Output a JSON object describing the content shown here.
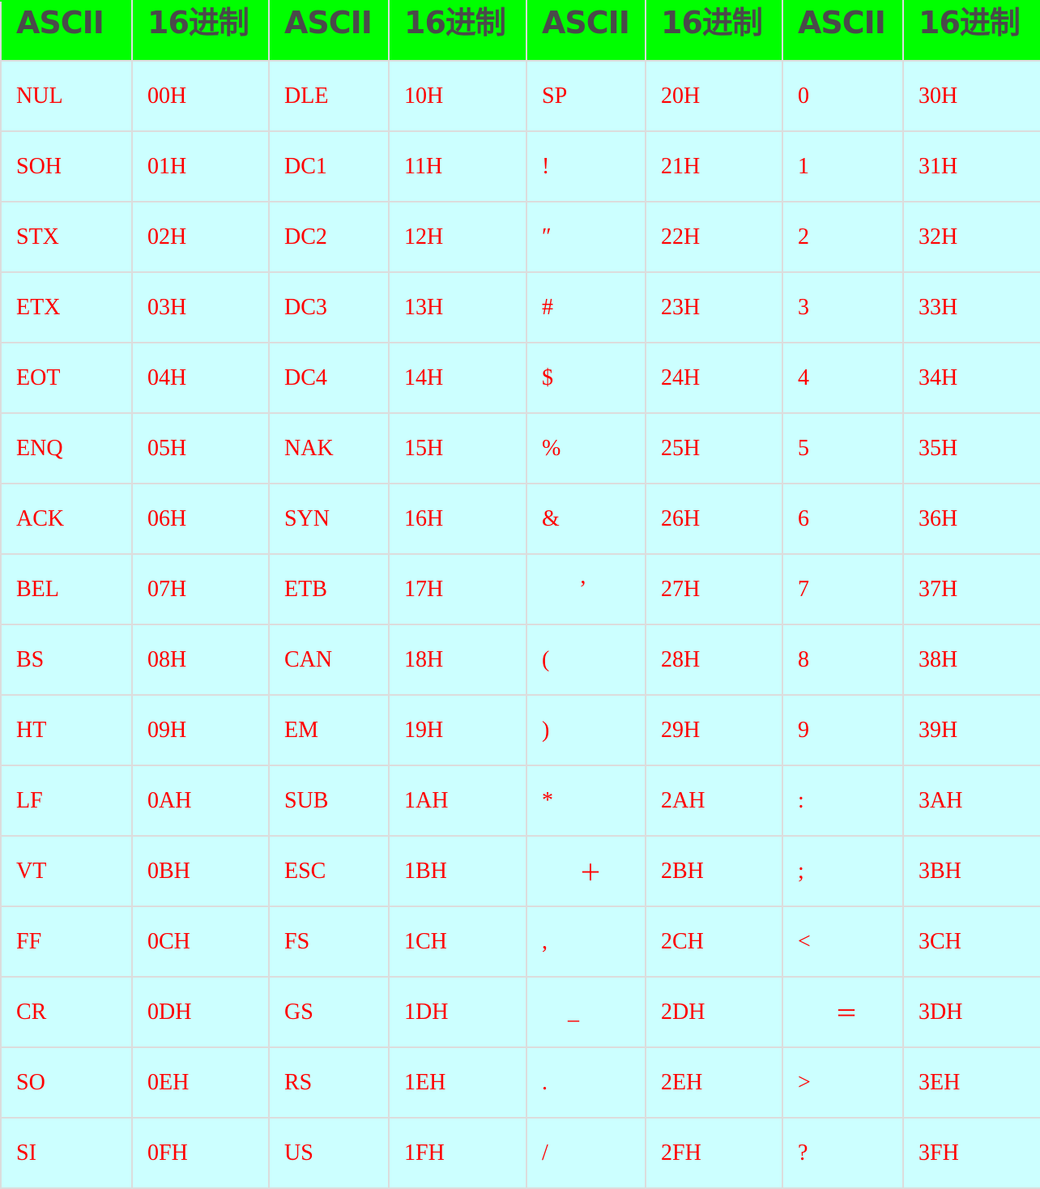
{
  "header": [
    "ASCII",
    "16进制",
    "ASCII",
    "16进制",
    "ASCII",
    "16进制",
    "ASCII",
    "16进制"
  ],
  "rows": [
    [
      "NUL",
      "00H",
      "DLE",
      "10H",
      "SP",
      "20H",
      "0",
      "30H"
    ],
    [
      "SOH",
      "01H",
      "DC1",
      "11H",
      "!",
      "21H",
      "1",
      "31H"
    ],
    [
      "STX",
      "02H",
      "DC2",
      "12H",
      "″",
      "22H",
      "2",
      "32H"
    ],
    [
      "ETX",
      "03H",
      "DC3",
      "13H",
      "#",
      "23H",
      "3",
      "33H"
    ],
    [
      "EOT",
      "04H",
      "DC4",
      "14H",
      "$",
      "24H",
      "4",
      "34H"
    ],
    [
      "ENQ",
      "05H",
      "NAK",
      "15H",
      "%",
      "25H",
      "5",
      "35H"
    ],
    [
      "ACK",
      "06H",
      "SYN",
      "16H",
      "&",
      "26H",
      "6",
      "36H"
    ],
    [
      "BEL",
      "07H",
      "ETB",
      "17H",
      "’",
      "27H",
      "7",
      "37H"
    ],
    [
      "BS",
      "08H",
      "CAN",
      "18H",
      "(",
      "28H",
      "8",
      "38H"
    ],
    [
      "HT",
      "09H",
      "EM",
      "19H",
      ")",
      "29H",
      "9",
      "39H"
    ],
    [
      "LF",
      "0AH",
      "SUB",
      "1AH",
      "*",
      "2AH",
      ":",
      "3AH"
    ],
    [
      "VT",
      "0BH",
      "ESC",
      "1BH",
      "＋",
      "2BH",
      ";",
      "3BH"
    ],
    [
      "FF",
      "0CH",
      "FS",
      "1CH",
      ",",
      "2CH",
      "<",
      "3CH"
    ],
    [
      "CR",
      "0DH",
      "GS",
      "1DH",
      "_",
      "2DH",
      "＝",
      "3DH"
    ],
    [
      "SO",
      "0EH",
      "RS",
      "1EH",
      ".",
      "2EH",
      ">",
      "3EH"
    ],
    [
      "SI",
      "0FH",
      "US",
      "1FH",
      "/",
      "2FH",
      "?",
      "3FH"
    ]
  ],
  "colors": {
    "header_bg": "#00ff00",
    "header_text": "#4a4a4a",
    "cell_bg": "#ccffff",
    "cell_text": "#ff0000",
    "grid": "#dcdcdc"
  }
}
